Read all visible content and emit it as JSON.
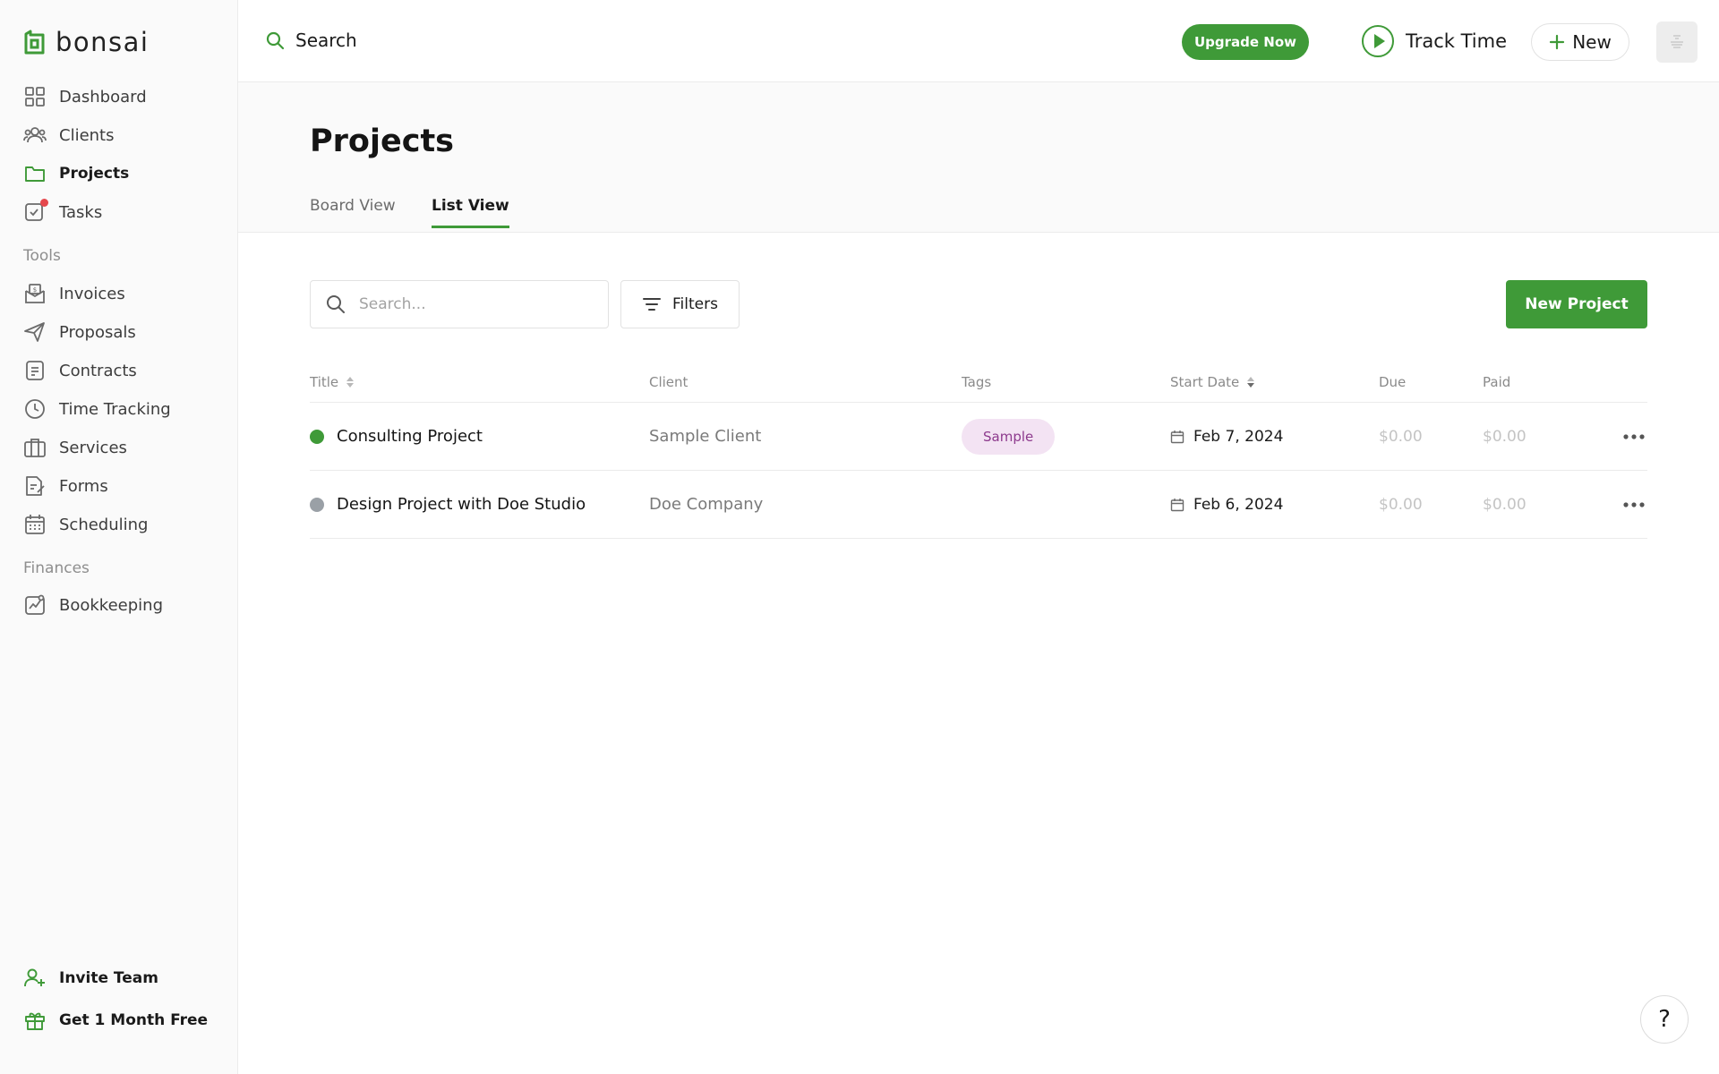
{
  "app": {
    "brand": "bonsai"
  },
  "sidebar": {
    "main_items": [
      {
        "label": "Dashboard",
        "icon": "dashboard-icon"
      },
      {
        "label": "Clients",
        "icon": "clients-icon"
      },
      {
        "label": "Projects",
        "icon": "folder-icon",
        "active": true
      },
      {
        "label": "Tasks",
        "icon": "tasks-icon",
        "has_notification": true
      }
    ],
    "tools_label": "Tools",
    "tools_items": [
      {
        "label": "Invoices",
        "icon": "invoice-icon"
      },
      {
        "label": "Proposals",
        "icon": "paper-plane-icon"
      },
      {
        "label": "Contracts",
        "icon": "contract-icon"
      },
      {
        "label": "Time Tracking",
        "icon": "clock-icon"
      },
      {
        "label": "Services",
        "icon": "briefcase-icon"
      },
      {
        "label": "Forms",
        "icon": "form-icon"
      },
      {
        "label": "Scheduling",
        "icon": "calendar-icon"
      }
    ],
    "finances_label": "Finances",
    "finances_items": [
      {
        "label": "Bookkeeping",
        "icon": "chart-icon"
      }
    ],
    "bottom_items": [
      {
        "label": "Invite Team",
        "icon": "add-user-icon"
      },
      {
        "label": "Get 1 Month Free",
        "icon": "gift-icon"
      }
    ]
  },
  "topbar": {
    "search_label": "Search",
    "upgrade_label": "Upgrade Now",
    "track_time_label": "Track Time",
    "new_label": "New"
  },
  "page": {
    "title": "Projects",
    "tabs": [
      {
        "label": "Board View",
        "active": false
      },
      {
        "label": "List View",
        "active": true
      }
    ]
  },
  "toolbar": {
    "search_placeholder": "Search...",
    "filters_label": "Filters",
    "new_project_label": "New Project"
  },
  "table": {
    "columns": {
      "title": "Title",
      "client": "Client",
      "tags": "Tags",
      "start_date": "Start Date",
      "due": "Due",
      "paid": "Paid"
    },
    "rows": [
      {
        "title": "Consulting Project",
        "status_color": "#3f9a38",
        "client": "Sample Client",
        "tag": "Sample",
        "start_date": "Feb 7, 2024",
        "due": "$0.00",
        "paid": "$0.00"
      },
      {
        "title": "Design Project with Doe Studio",
        "status_color": "#9aa0a6",
        "client": "Doe Company",
        "tag": "",
        "start_date": "Feb 6, 2024",
        "due": "$0.00",
        "paid": "$0.00"
      }
    ]
  },
  "help": {
    "label": "?"
  },
  "colors": {
    "brand_green": "#3f9a38",
    "tag_background": "#f3e3f3",
    "tag_text": "#8d3a8d",
    "notification_red": "#e5484d"
  }
}
